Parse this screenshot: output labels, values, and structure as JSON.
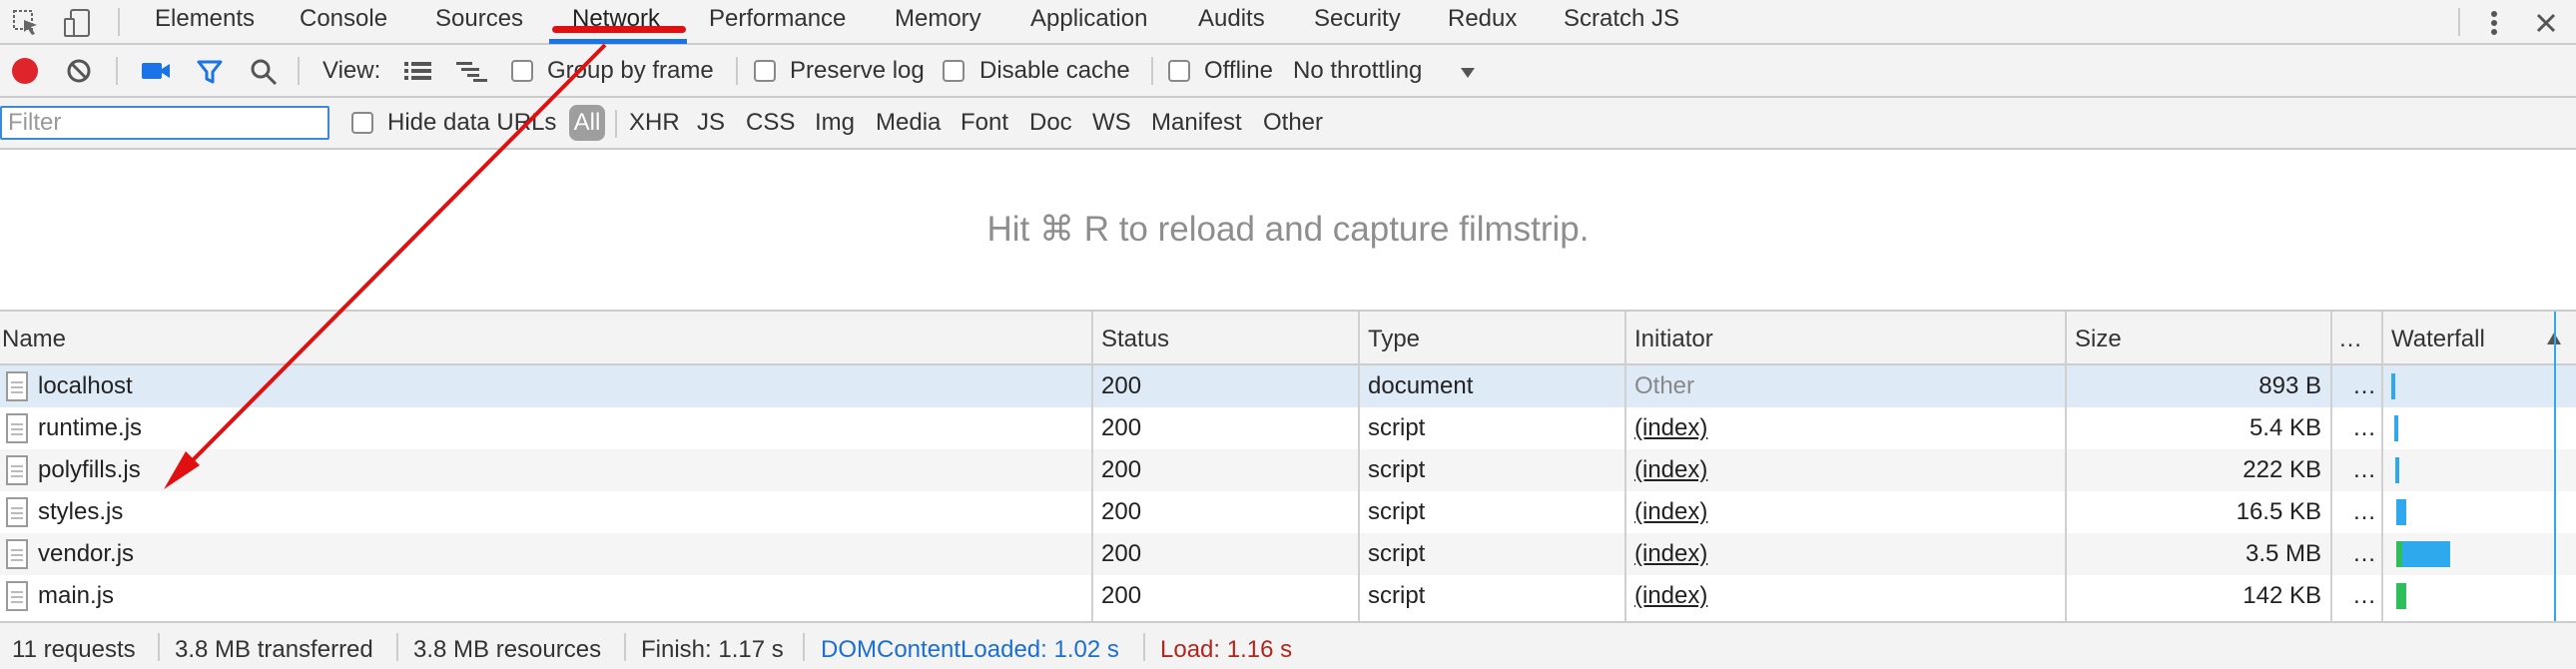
{
  "tabs": [
    "Elements",
    "Console",
    "Sources",
    "Network",
    "Performance",
    "Memory",
    "Application",
    "Audits",
    "Security",
    "Redux",
    "Scratch JS"
  ],
  "toolbar": {
    "view_label": "View:",
    "group_by_frame": "Group by frame",
    "preserve_log": "Preserve log",
    "disable_cache": "Disable cache",
    "offline": "Offline",
    "throttling": "No throttling"
  },
  "filterbar": {
    "placeholder": "Filter",
    "hide_data_urls": "Hide data URLs",
    "types": [
      "All",
      "XHR",
      "JS",
      "CSS",
      "Img",
      "Media",
      "Font",
      "Doc",
      "WS",
      "Manifest",
      "Other"
    ]
  },
  "filmstrip_hint": "Hit ⌘ R to reload and capture filmstrip.",
  "table": {
    "headers": {
      "name": "Name",
      "status": "Status",
      "type": "Type",
      "initiator": "Initiator",
      "size": "Size",
      "more": "…",
      "waterfall": "Waterfall"
    },
    "rows": [
      {
        "name": "localhost",
        "status": "200",
        "type": "document",
        "initiator": "Other",
        "size": "893 B",
        "more": "…"
      },
      {
        "name": "runtime.js",
        "status": "200",
        "type": "script",
        "initiator": "(index)",
        "size": "5.4 KB",
        "more": "…"
      },
      {
        "name": "polyfills.js",
        "status": "200",
        "type": "script",
        "initiator": "(index)",
        "size": "222 KB",
        "more": "…"
      },
      {
        "name": "styles.js",
        "status": "200",
        "type": "script",
        "initiator": "(index)",
        "size": "16.5 KB",
        "more": "…"
      },
      {
        "name": "vendor.js",
        "status": "200",
        "type": "script",
        "initiator": "(index)",
        "size": "3.5 MB",
        "more": "…"
      },
      {
        "name": "main.js",
        "status": "200",
        "type": "script",
        "initiator": "(index)",
        "size": "142 KB",
        "more": "…"
      }
    ]
  },
  "status": {
    "requests": "11 requests",
    "transferred": "3.8 MB transferred",
    "resources": "3.8 MB resources",
    "finish": "Finish: 1.17 s",
    "domcontentloaded": "DOMContentLoaded: 1.02 s",
    "load": "Load: 1.16 s"
  },
  "colors": {
    "accent": "#1a73e8",
    "record": "#e0242c",
    "dcl": "#1a6fd1",
    "load": "#b3261e",
    "annotation": "#e01010",
    "waterfall_blue": "#2ea9ed",
    "waterfall_green": "#2fbf5a"
  }
}
